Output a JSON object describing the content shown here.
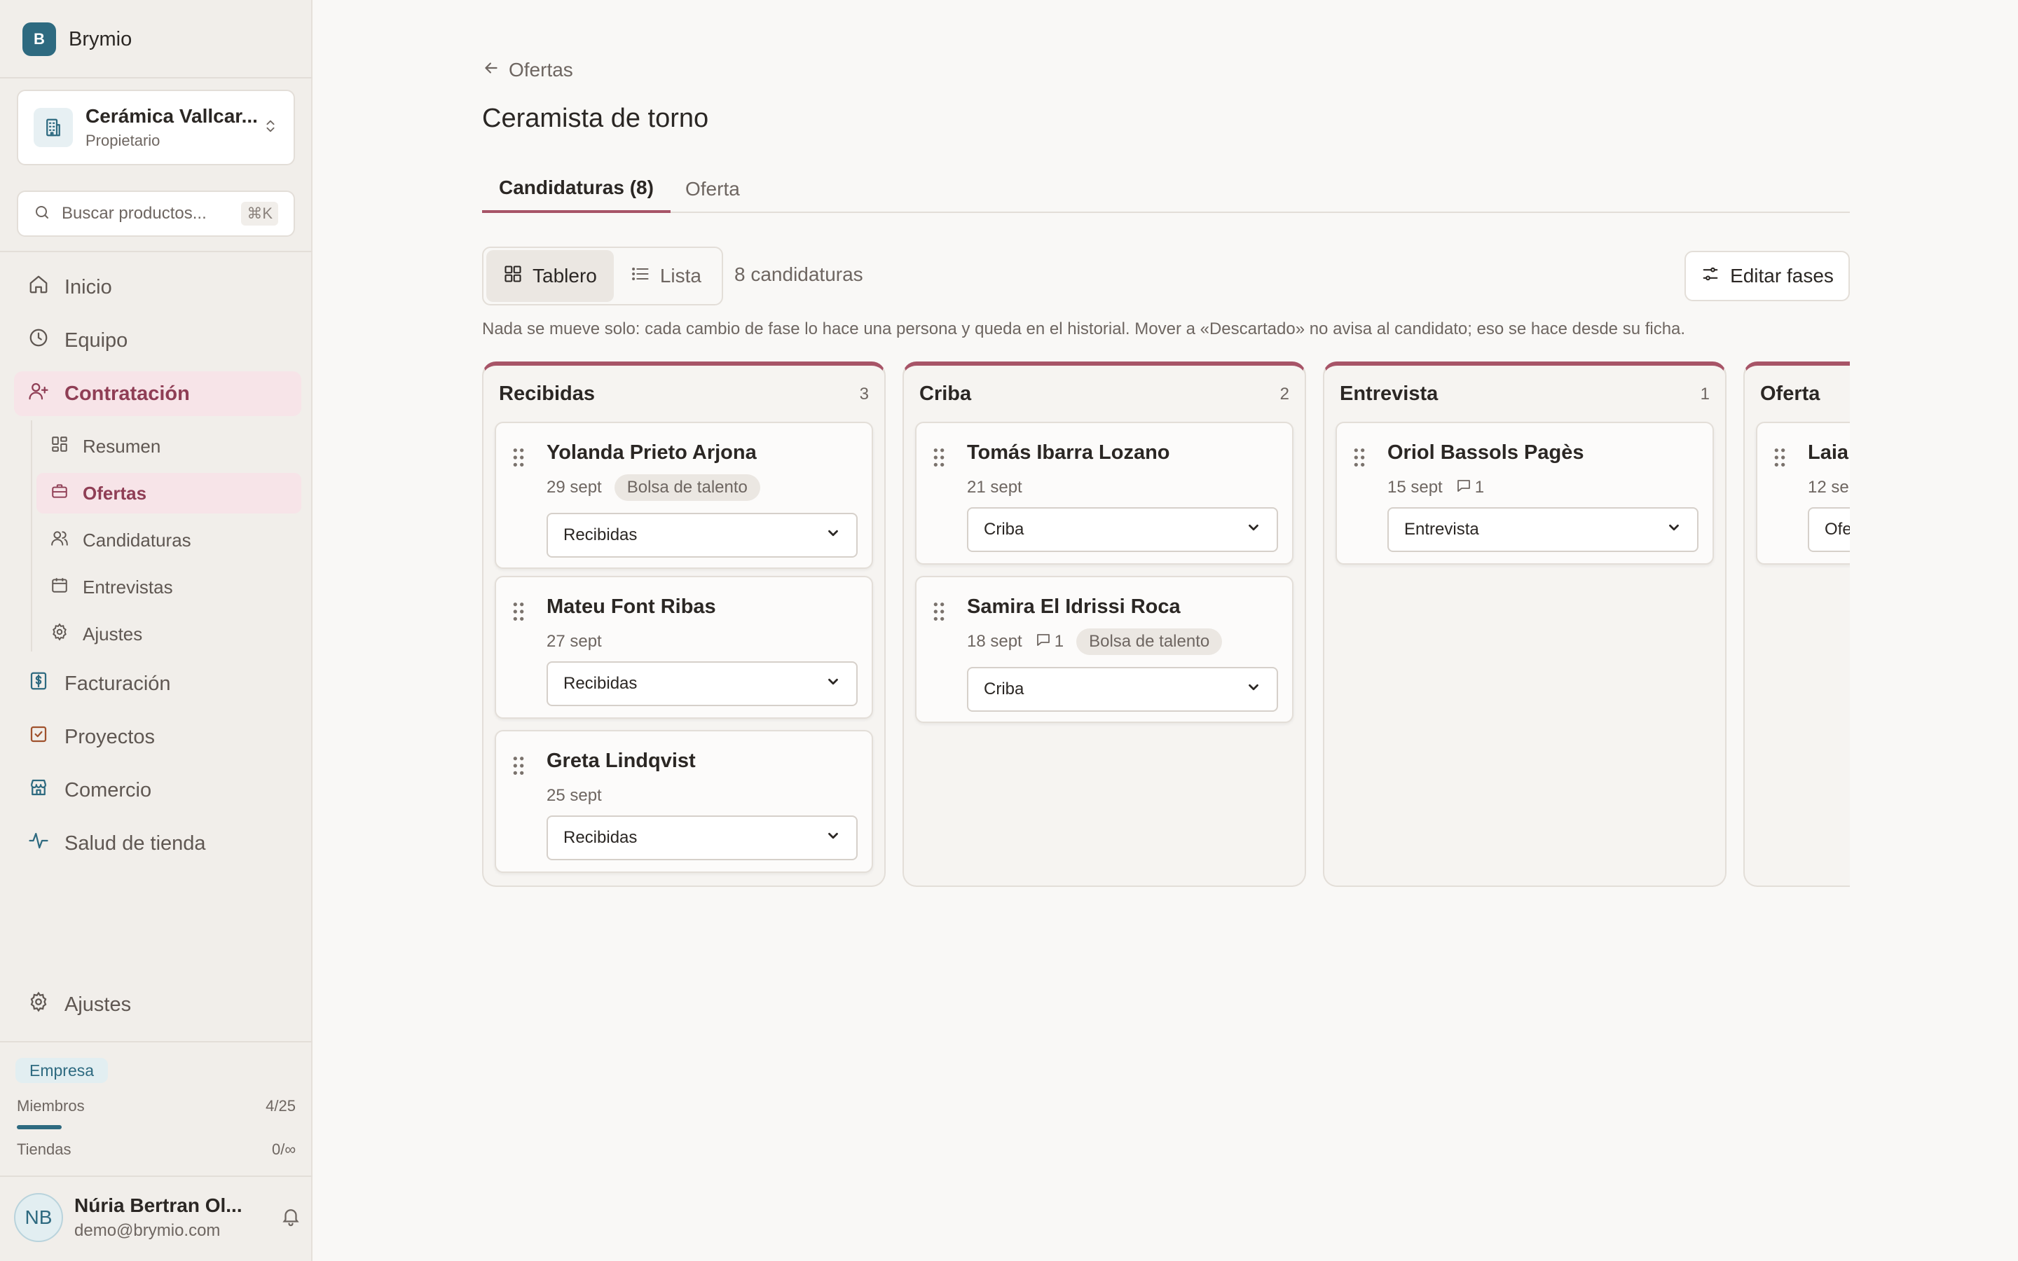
{
  "app": {
    "logo_letter": "B",
    "name": "Brymio"
  },
  "org": {
    "name": "Cerámica Vallcar...",
    "role": "Propietario"
  },
  "search": {
    "placeholder": "Buscar productos...",
    "shortcut": "⌘K"
  },
  "nav": {
    "inicio": "Inicio",
    "equipo": "Equipo",
    "contratacion": "Contratación",
    "sub": {
      "resumen": "Resumen",
      "ofertas": "Ofertas",
      "candidaturas": "Candidaturas",
      "entrevistas": "Entrevistas",
      "ajustes": "Ajustes"
    },
    "facturacion": "Facturación",
    "proyectos": "Proyectos",
    "comercio": "Comercio",
    "salud": "Salud de tienda",
    "ajustes": "Ajustes"
  },
  "plan": {
    "badge": "Empresa",
    "members_label": "Miembros",
    "members_value": "4/25",
    "members_fraction": 0.16,
    "stores_label": "Tiendas",
    "stores_value": "0/∞"
  },
  "user": {
    "initials": "NB",
    "name": "Núria Bertran Ol...",
    "email": "demo@brymio.com"
  },
  "page": {
    "back_label": "Ofertas",
    "title": "Ceramista de torno",
    "tabs": [
      "Candidaturas (8)",
      "Oferta"
    ],
    "view_board": "Tablero",
    "view_list": "Lista",
    "count_label": "8 candidaturas",
    "edit_button": "Editar fases",
    "notice": "Nada se mueve solo: cada cambio de fase lo hace una persona y queda en el historial. Mover a «Descartado» no avisa al candidato; eso se hace desde su ficha."
  },
  "colors": {
    "accent": "#a75467",
    "brand": "#2e6a80"
  },
  "board": {
    "columns": [
      {
        "title": "Recibidas",
        "count": "3",
        "cards": [
          {
            "name": "Yolanda Prieto Arjona",
            "date": "29 sept",
            "comments": "",
            "tag": "Bolsa de talento",
            "stage": "Recibidas"
          },
          {
            "name": "Mateu Font Ribas",
            "date": "27 sept",
            "comments": "",
            "tag": "",
            "stage": "Recibidas"
          },
          {
            "name": "Greta Lindqvist",
            "date": "25 sept",
            "comments": "",
            "tag": "",
            "stage": "Recibidas"
          }
        ]
      },
      {
        "title": "Criba",
        "count": "2",
        "cards": [
          {
            "name": "Tomás Ibarra Lozano",
            "date": "21 sept",
            "comments": "",
            "tag": "",
            "stage": "Criba"
          },
          {
            "name": "Samira El Idrissi Roca",
            "date": "18 sept",
            "comments": "1",
            "tag": "Bolsa de talento",
            "stage": "Criba"
          }
        ]
      },
      {
        "title": "Entrevista",
        "count": "1",
        "cards": [
          {
            "name": "Oriol Bassols Pagès",
            "date": "15 sept",
            "comments": "1",
            "tag": "",
            "stage": "Entrevista"
          }
        ]
      },
      {
        "title": "Oferta",
        "count": "",
        "cards": [
          {
            "name": "Laia",
            "date": "12 se",
            "comments": "",
            "tag": "",
            "stage": "Ofe"
          }
        ]
      }
    ]
  }
}
